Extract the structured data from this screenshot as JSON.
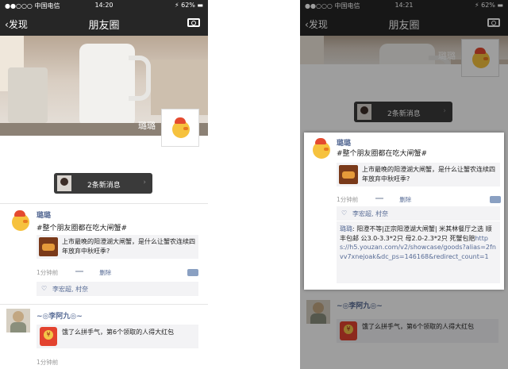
{
  "status": {
    "carrier": "●●○○○ 中国电信",
    "time_left": "14:20",
    "time_right": "14:21",
    "battery": "62%"
  },
  "nav": {
    "back": "发现",
    "title": "朋友圈"
  },
  "cover": {
    "nickname": "璐璐"
  },
  "toast": {
    "text": "2条新消息"
  },
  "post1": {
    "name": "璐璐",
    "text": "#整个朋友圈都在吃大闸蟹#",
    "share_text": "上市最晚的阳澄湖大闸蟹，是什么让蟹农连续四年放弃中秋旺季?",
    "time": "1分钟前",
    "delete": "删除",
    "likes": "李宏超, 村奈",
    "comment": {
      "name": "璐璐",
      "body": ": 阳澄不等|正宗阳澄湖大闸蟹| 米其林餐厅之选 顺丰包邮 公3.0-3.3*2只 母2.0-2.3*2只 死蟹包赔",
      "url": "https://h5.youzan.com/v2/showcase/goods?alias=2fnvv7xnejoak&dc_ps=146168&redirect_count=1"
    }
  },
  "post2": {
    "name": "李阿九",
    "redpack_text": "饿了么拼手气，第6个领取的人得大红包",
    "time": "1分钟前"
  }
}
